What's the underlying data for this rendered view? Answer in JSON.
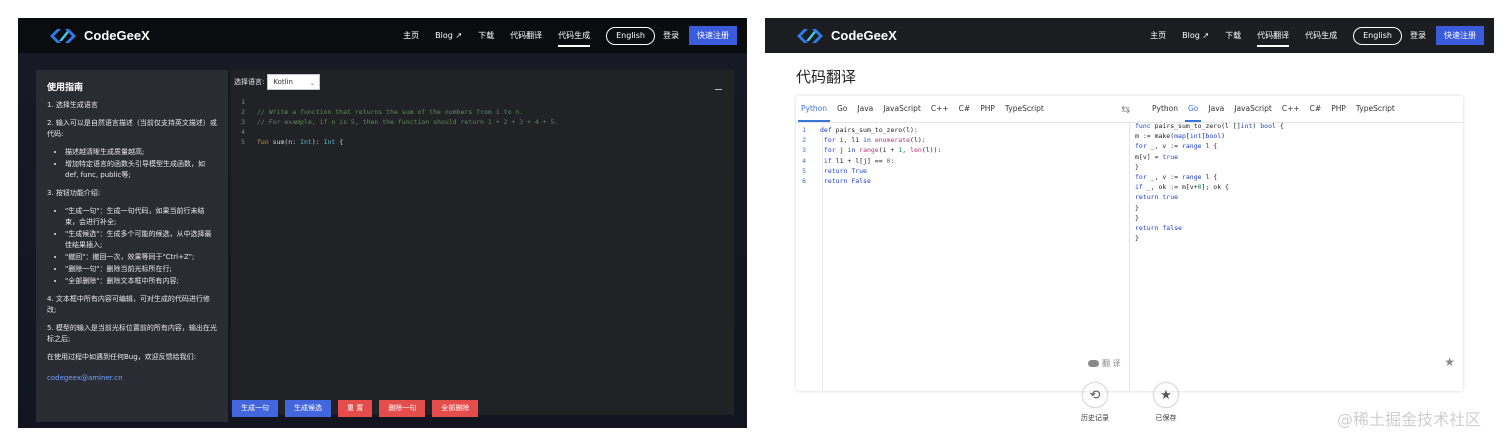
{
  "colors": {
    "accent": "#3a5bdc",
    "danger": "#e54d4d",
    "active_tab": "#3d74d8"
  },
  "left": {
    "nav": {
      "brand": "CodeGeeX",
      "links": [
        "主页",
        "Blog ↗",
        "下载",
        "代码翻译",
        "代码生成"
      ],
      "active_index": 4,
      "lang_button": "English",
      "login": "登录",
      "register": "快速注册"
    },
    "guide": {
      "title": "使用指南",
      "p1": "1. 选择生成语言",
      "p2": "2. 输入可以是自然语言描述（当前仅支持英文描述）或代码:",
      "p2_items": [
        "描述越清晰生成质量越高;",
        "增加特定语言的函数头引导模型生成函数，如def, func, public等;"
      ],
      "p3": "3. 按钮功能介绍:",
      "p3_items": [
        "\"生成一句\"：生成一句代码，如果当前行未结束，会进行补全;",
        "\"生成候选\"：生成多个可能的候选，从中选择最佳结果插入;",
        "\"撤回\"：撤回一次，效果等同于\"Ctrl+Z\";",
        "\"删除一句\"：删除当前光标所在行;",
        "\"全部删除\"：删除文本框中所有内容;"
      ],
      "p4": "4. 文本框中所有内容可编辑，可对生成的代码进行修改;",
      "p5": "5. 模型的输入是当前光标位置前的所有内容，输出在光标之后;",
      "p6": "在使用过程中如遇到任何Bug，欢迎反馈给我们:",
      "email": "codegeex@aminer.cn"
    },
    "editor": {
      "lang_label": "选择语言:",
      "lang_value": "Kotlin",
      "lines": [
        {
          "n": "1",
          "text": ""
        },
        {
          "n": "2",
          "text": "// Write a function that returns the sum of the numbers from 1 to n."
        },
        {
          "n": "3",
          "text": "// For example, if n is 5, then the function should return 1 + 2 + 3 + 4 + 5."
        },
        {
          "n": "4",
          "text": ""
        },
        {
          "n": "5",
          "text": "fun sum(n: Int): Int {"
        }
      ]
    },
    "buttons": [
      "生成一句",
      "生成候选",
      "重 置",
      "删除一句",
      "全部删除"
    ]
  },
  "right": {
    "nav": {
      "brand": "CodeGeeX",
      "links": [
        "主页",
        "Blog ↗",
        "下载",
        "代码翻译",
        "代码生成"
      ],
      "active_index": 3,
      "lang_button": "English",
      "login": "登录",
      "register": "快速注册"
    },
    "title": "代码翻译",
    "source_tabs": [
      "Python",
      "Go",
      "Java",
      "JavaScript",
      "C++",
      "C#",
      "PHP",
      "TypeScript"
    ],
    "source_active": 0,
    "target_tabs": [
      "Python",
      "Go",
      "Java",
      "JavaScript",
      "C++",
      "C#",
      "PHP",
      "TypeScript"
    ],
    "target_active": 1,
    "source_lines": [
      "1",
      "2",
      "3",
      "4",
      "5",
      "6"
    ],
    "translate_label": "翻 译",
    "actions": [
      "历史记录",
      "已保存"
    ]
  },
  "watermark": "@稀土掘金技术社区"
}
